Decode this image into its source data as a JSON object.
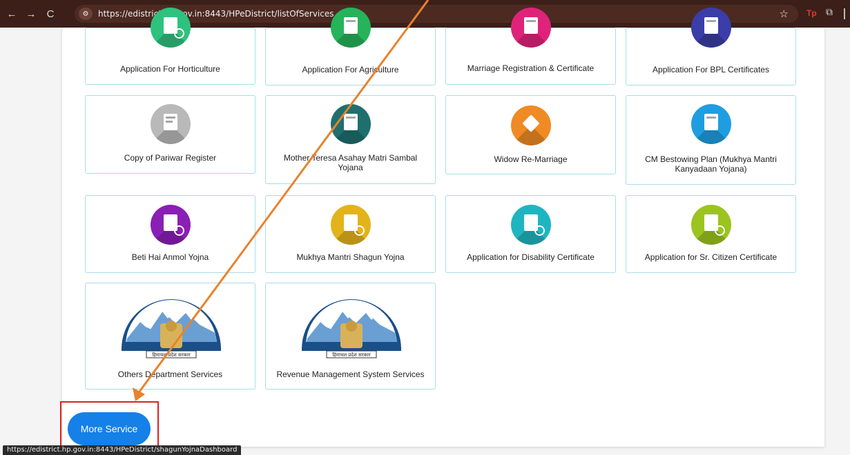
{
  "browser": {
    "url": "https://edistrict.hp.gov.in:8443/HPeDistrict/listOfServices",
    "status_url": "https://edistrict.hp.gov.in:8443/HPeDistrict/shagunYojnaDashboard",
    "back_icon": "←",
    "forward_icon": "→",
    "reload_icon": "C",
    "site_icon": "⚙",
    "star_icon": "☆",
    "ext_icon": "Tp",
    "puzzle_icon": "⧉"
  },
  "services": [
    {
      "label": "Application For Horticulture",
      "color": "#2ec27e"
    },
    {
      "label": "Application For Agriculture",
      "color": "#26b35a"
    },
    {
      "label": "Marriage Registration & Certificate",
      "color": "#e0237a"
    },
    {
      "label": "Application For BPL Certificates",
      "color": "#3b3da8"
    },
    {
      "label": "Copy of Pariwar Register",
      "color": "#b9b9b9"
    },
    {
      "label": "Mother Teresa Asahay Matri Sambal Yojana",
      "color": "#1f6f6f"
    },
    {
      "label": "Widow Re-Marriage",
      "color": "#f08a24"
    },
    {
      "label": "CM Bestowing Plan (Mukhya Mantri Kanyadaan Yojana)",
      "color": "#1e9ee0"
    },
    {
      "label": "Beti Hai Anmol Yojna",
      "color": "#8a1fb5"
    },
    {
      "label": "Mukhya Mantri Shagun Yojna",
      "color": "#e3b31b"
    },
    {
      "label": "Application for Disability Certificate",
      "color": "#1fb5c0"
    },
    {
      "label": "Application for Sr. Citizen Certificate",
      "color": "#9bc41f"
    },
    {
      "label": "Others Department Services",
      "color": ""
    },
    {
      "label": "Revenue Management System Services",
      "color": ""
    }
  ],
  "emblem_text": "हिमाचल प्रदेश सरकार",
  "more_button": "More Service",
  "highlight_color": "#e0201b",
  "arrow_color": "#e8832b"
}
